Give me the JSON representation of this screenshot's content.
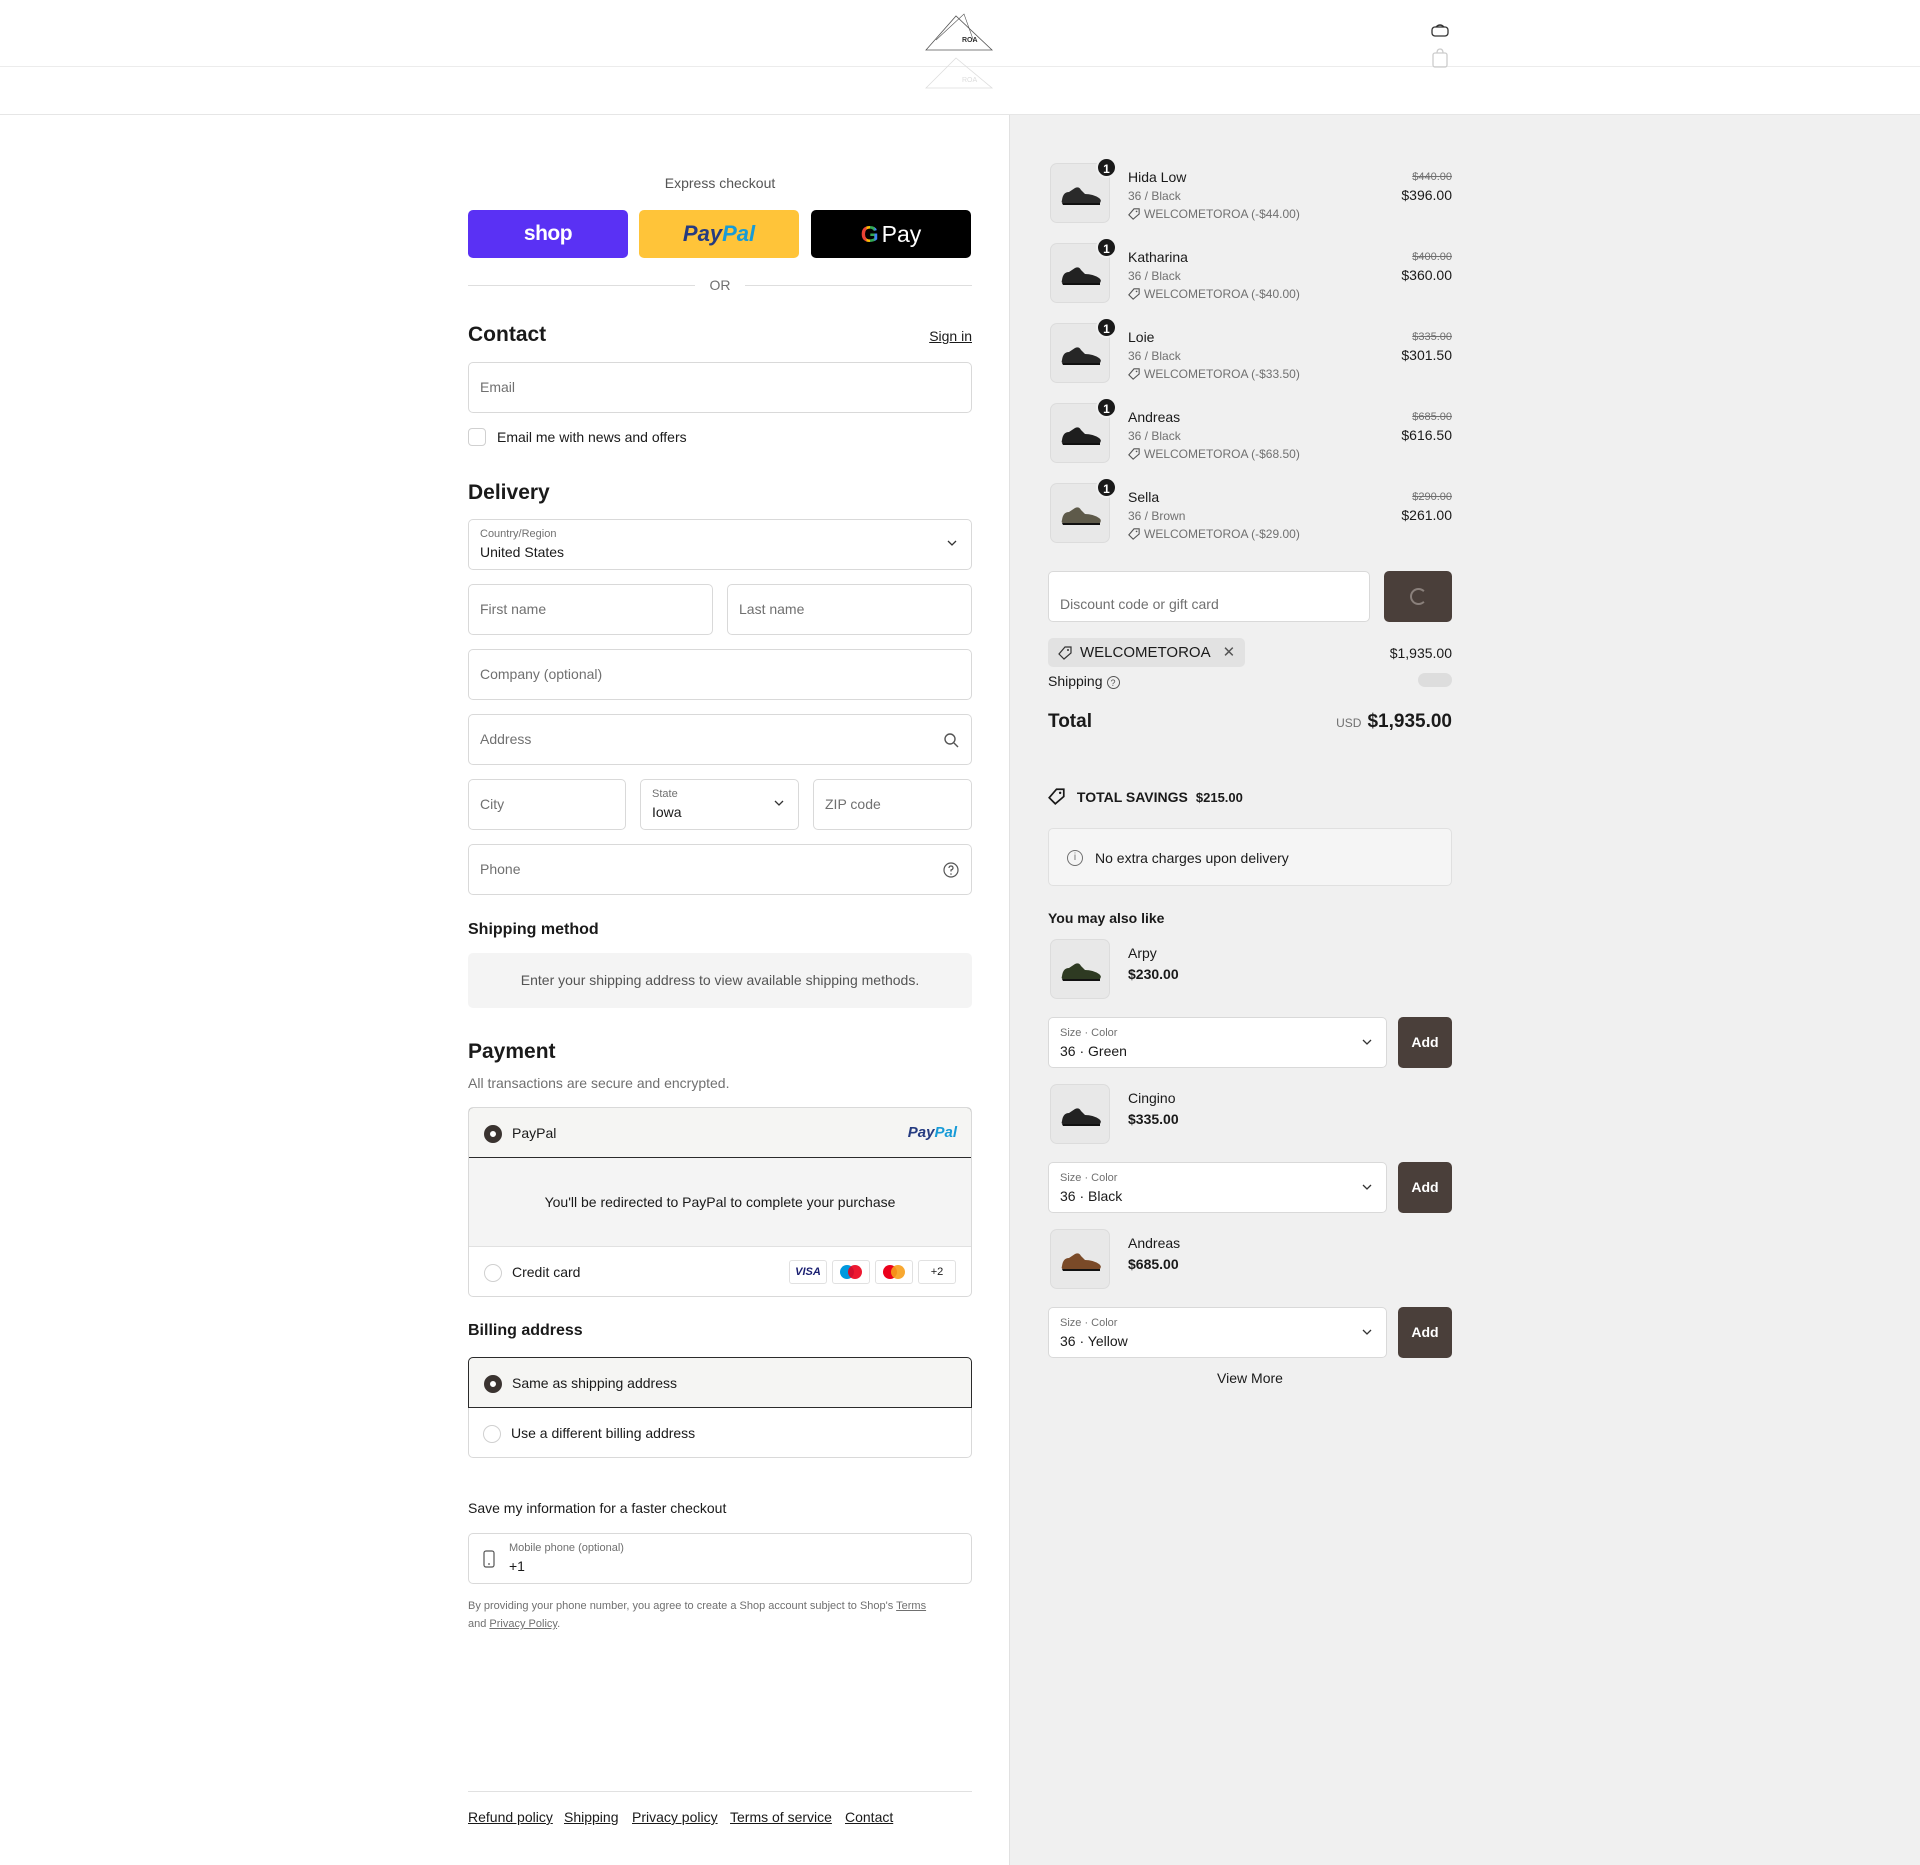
{
  "brand": {
    "logo_text": "ROA"
  },
  "express": {
    "title": "Express checkout",
    "shop_label": "shop",
    "paypal_part1": "Pay",
    "paypal_part2": "Pal",
    "gpay_g": "G",
    "gpay_label": "Pay",
    "or_label": "OR"
  },
  "contact": {
    "title": "Contact",
    "sign_in": "Sign in",
    "email_placeholder": "Email",
    "newsletter_label": "Email me with news and offers"
  },
  "delivery": {
    "title": "Delivery",
    "country_label": "Country/Region",
    "country_value": "United States",
    "first_name_placeholder": "First name",
    "last_name_placeholder": "Last name",
    "company_placeholder": "Company (optional)",
    "address_placeholder": "Address",
    "city_placeholder": "City",
    "state_label": "State",
    "state_value": "Iowa",
    "zip_placeholder": "ZIP code",
    "phone_placeholder": "Phone"
  },
  "shipping_method": {
    "title": "Shipping method",
    "notice": "Enter your shipping address to view available shipping methods."
  },
  "payment": {
    "title": "Payment",
    "subtitle": "All transactions are secure and encrypted.",
    "paypal_label": "PayPal",
    "paypal_logo_a": "Pay",
    "paypal_logo_b": "Pal",
    "redirect_text": "You'll be redirected to PayPal to complete your purchase",
    "credit_card_label": "Credit card",
    "cards": [
      "VISA",
      "maestro",
      "mastercard",
      "+2"
    ]
  },
  "billing": {
    "title": "Billing address",
    "same_label": "Same as shipping address",
    "different_label": "Use a different billing address"
  },
  "save_info": {
    "title": "Save my information for a faster checkout",
    "phone_label": "Mobile phone (optional)",
    "phone_value": "+1",
    "legal_prefix": "By providing your phone number, you agree to create a Shop account subject to Shop's",
    "terms": "Terms",
    "and": "and",
    "privacy": "Privacy Policy",
    "period": "."
  },
  "footer": {
    "links": [
      "Refund policy",
      "Shipping",
      "Privacy policy",
      "Terms of service",
      "Contact"
    ]
  },
  "order": {
    "items": [
      {
        "name": "Hida Low",
        "variant": "36 / Black",
        "discount": "WELCOMETOROA (-$44.00)",
        "original": "$440.00",
        "price": "$396.00",
        "qty": "1",
        "color": "#2a2a2a"
      },
      {
        "name": "Katharina",
        "variant": "36 / Black",
        "discount": "WELCOMETOROA (-$40.00)",
        "original": "$400.00",
        "price": "$360.00",
        "qty": "1",
        "color": "#222222"
      },
      {
        "name": "Loie",
        "variant": "36 / Black",
        "discount": "WELCOMETOROA (-$33.50)",
        "original": "$335.00",
        "price": "$301.50",
        "qty": "1",
        "color": "#262626"
      },
      {
        "name": "Andreas",
        "variant": "36 / Black",
        "discount": "WELCOMETOROA (-$68.50)",
        "original": "$685.00",
        "price": "$616.50",
        "qty": "1",
        "color": "#1e1e1e"
      },
      {
        "name": "Sella",
        "variant": "36 / Brown",
        "discount": "WELCOMETOROA (-$29.00)",
        "original": "$290.00",
        "price": "$261.00",
        "qty": "1",
        "color": "#5e5a4a"
      }
    ],
    "discount_placeholder": "Discount code or gift card",
    "applied_code": "WELCOMETOROA",
    "subtotal": "$1,935.00",
    "shipping_label": "Shipping",
    "total_label": "Total",
    "currency": "USD",
    "total": "$1,935.00",
    "savings_label": "TOTAL SAVINGS",
    "savings_amount": "$215.00",
    "no_charges": "No extra charges upon delivery"
  },
  "upsell": {
    "title": "You may also like",
    "select_label": "Size · Color",
    "add_label": "Add",
    "view_more": "View More",
    "items": [
      {
        "name": "Arpy",
        "price": "$230.00",
        "option": "36 · Green",
        "color": "#2e3a22"
      },
      {
        "name": "Cingino",
        "price": "$335.00",
        "option": "36 · Black",
        "color": "#222222"
      },
      {
        "name": "Andreas",
        "price": "$685.00",
        "option": "36 · Yellow",
        "color": "#7a4a28"
      }
    ]
  },
  "colors": {
    "shop_purple": "#5a31f4",
    "paypal_yellow": "#ffc439",
    "button_brown": "#4a3f3a",
    "summary_bg": "#f0f0f0"
  }
}
